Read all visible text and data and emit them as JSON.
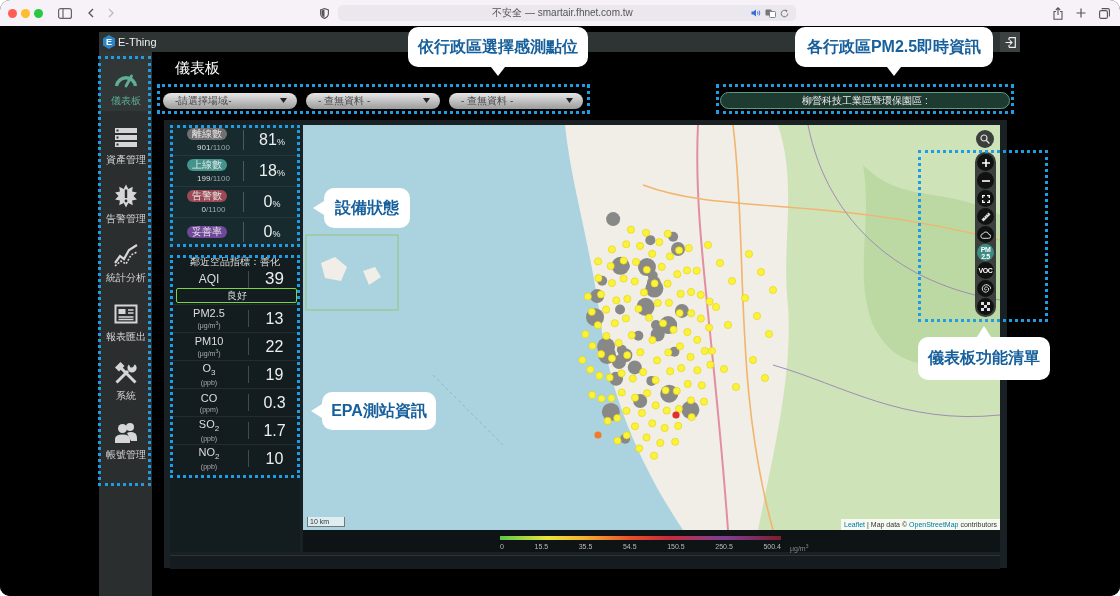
{
  "browser": {
    "nav": [
      {
        "kind": "back",
        "disabled": false
      },
      {
        "kind": "forward",
        "disabled": true
      }
    ],
    "address": "不安全 — smartair.fhnet.com.tw"
  },
  "app": {
    "logo_letter": "E",
    "name": "E-Thing"
  },
  "sidebar": {
    "items": [
      {
        "kind": "gauge",
        "label": "儀表板",
        "selected": true
      },
      {
        "kind": "server",
        "label": "資產管理",
        "selected": false
      },
      {
        "kind": "alert",
        "label": "告警管理",
        "selected": false
      },
      {
        "kind": "chart",
        "label": "統計分析",
        "selected": false
      },
      {
        "kind": "report",
        "label": "報表匯出",
        "selected": false
      },
      {
        "kind": "tools",
        "label": "系統",
        "selected": false
      },
      {
        "kind": "users",
        "label": "帳號管理",
        "selected": false
      }
    ]
  },
  "page_title": "儀表板",
  "filters": [
    {
      "value": "-請選擇場域-"
    },
    {
      "value": "- 查無資料 -"
    },
    {
      "value": "- 查無資料 -"
    }
  ],
  "district_info": {
    "text": "柳營科技工業區暨環保園區 :"
  },
  "devices": [
    {
      "label": "離線數",
      "color": "#707070",
      "percent": "81",
      "unit": "%",
      "count": "901",
      "total": "/1100"
    },
    {
      "label": "上線數",
      "color": "#43948c",
      "percent": "18",
      "unit": "%",
      "count": "199",
      "total": "/1100"
    },
    {
      "label": "告警數",
      "color": "#9a4955",
      "percent": "0",
      "unit": "%",
      "count": "0",
      "total": "/1100"
    },
    {
      "label": "妥善率",
      "color": "#70479a",
      "percent": "0",
      "unit": "%"
    }
  ],
  "epa": {
    "title": "鄰近空品指標：善化",
    "aqi_label": "AQI",
    "aqi": "39",
    "status": "良好",
    "pollutants": [
      {
        "name": "PM2.5",
        "unit": "(μg/m$^{3}$)",
        "value": "13"
      },
      {
        "name": "PM10",
        "unit": "(μg/m$^{3}$)",
        "value": "22"
      },
      {
        "name": "O$_{3}$",
        "unit": "(ppb)",
        "value": "19"
      },
      {
        "name": "CO",
        "unit": "(ppm)",
        "value": "0.3"
      },
      {
        "name": "SO$_{2}$",
        "unit": "(ppb)",
        "value": "1.7"
      },
      {
        "name": "NO$_{2}$",
        "unit": "(ppb)",
        "value": "10"
      }
    ]
  },
  "map": {
    "tools": [
      {
        "kind": "zoom-in",
        "selected": false
      },
      {
        "kind": "zoom-out",
        "selected": false
      },
      {
        "kind": "fullscreen",
        "selected": false
      },
      {
        "kind": "ruler",
        "selected": false
      },
      {
        "kind": "cloud",
        "selected": false
      },
      {
        "kind": "pm25",
        "label": "PM 2.5",
        "selected": true
      },
      {
        "kind": "voc",
        "label": "VOC",
        "selected": false
      },
      {
        "kind": "spiral",
        "selected": false
      },
      {
        "kind": "grid",
        "selected": false
      }
    ],
    "scale": "10 km",
    "attribution": [
      {
        "kind": "link",
        "text": "Leaflet"
      },
      {
        "kind": "text",
        "text": "| Map data ©"
      },
      {
        "kind": "link",
        "text": "OpenStreetMap"
      },
      {
        "kind": "text",
        "text": "contributors"
      }
    ]
  },
  "legend": {
    "ticks": [
      "0",
      "15.5",
      "35.5",
      "54.5",
      "150.5",
      "250.5",
      "500.4"
    ],
    "unit": "μg/m$^{3}$"
  },
  "annotations": [
    {
      "text": "依行政區選擇感測點位",
      "kind": "down"
    },
    {
      "text": "各行政區PM2.5即時資訊",
      "kind": "down"
    },
    {
      "text": "設備狀態",
      "kind": "left"
    },
    {
      "text": "EPA測站資訊",
      "kind": "left"
    },
    {
      "text": "儀表板功能清單",
      "kind": "up"
    }
  ]
}
